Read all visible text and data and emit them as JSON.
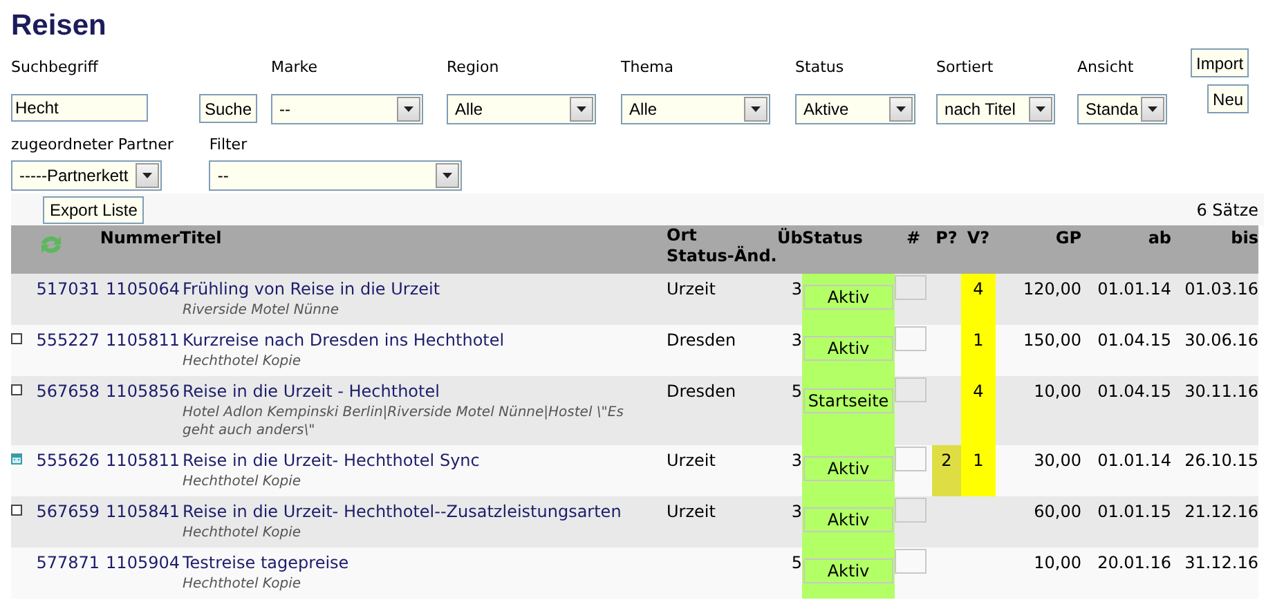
{
  "title": "Reisen",
  "search": {
    "label": "Suchbegriff",
    "value": "Hecht",
    "button": "Suche"
  },
  "selects": [
    {
      "label": "Marke",
      "value": "--"
    },
    {
      "label": "Region",
      "value": "Alle"
    },
    {
      "label": "Thema",
      "value": "Alle"
    },
    {
      "label": "Status",
      "value": "Aktive"
    },
    {
      "label": "Sortiert",
      "value": "nach Titel"
    },
    {
      "label": "Ansicht",
      "value": "Standa"
    }
  ],
  "import_button": "Import",
  "new_button": "Neu",
  "selects2": [
    {
      "label": "zugeordneter Partner",
      "value": "-----Partnerkett"
    },
    {
      "label": "Filter",
      "value": "--"
    }
  ],
  "export_button": "Export Liste",
  "record_count": "6 Sätze",
  "table": {
    "columns": {
      "nummer": "Nummer",
      "titel": "Titel",
      "ort": "Ort",
      "status_change": "Status-Änd.",
      "ub": "Üb",
      "status": "Status",
      "count": "#",
      "p": "P?",
      "v": "V?",
      "gp": "GP",
      "ab": "ab",
      "bis": "bis"
    },
    "rows": [
      {
        "kind": "none",
        "id": "517031",
        "nummer": "1105064",
        "title": "Frühling von Reise in die Urzeit",
        "subtitle": "Riverside Motel Nünne",
        "ort": "Urzeit",
        "ub": "3",
        "status": "Aktiv",
        "v": "4",
        "gp": "120,00",
        "ab": "01.01.14",
        "bis": "01.03.16"
      },
      {
        "kind": "box",
        "id": "555227",
        "nummer": "1105811",
        "title": "Kurzreise nach Dresden ins Hechthotel",
        "subtitle": "Hechthotel Kopie",
        "ort": "Dresden",
        "ub": "3",
        "status": "Aktiv",
        "v": "1",
        "gp": "150,00",
        "ab": "01.04.15",
        "bis": "30.06.16"
      },
      {
        "kind": "box",
        "id": "567658",
        "nummer": "1105856",
        "title": "Reise in die Urzeit - Hechthotel",
        "subtitle": "Hotel Adlon Kempinski Berlin|Riverside Motel Nünne|Hostel \\\"Es geht auch anders\\\"",
        "ort": "Dresden",
        "ub": "5",
        "status": "Startseite",
        "v": "4",
        "gp": "10,00",
        "ab": "01.04.15",
        "bis": "30.11.16"
      },
      {
        "kind": "calendar",
        "id": "555626",
        "nummer": "1105811",
        "title": "Reise in die Urzeit- Hechthotel Sync",
        "subtitle": "Hechthotel Kopie",
        "ort": "Urzeit",
        "ub": "3",
        "status": "Aktiv",
        "p": "2",
        "v": "1",
        "gp": "30,00",
        "ab": "01.01.14",
        "bis": "26.10.15"
      },
      {
        "kind": "box",
        "id": "567659",
        "nummer": "1105841",
        "title": "Reise in die Urzeit- Hechthotel--Zusatzleistungsarten",
        "subtitle": "Hechthotel Kopie",
        "ort": "Urzeit",
        "ub": "3",
        "status": "Aktiv",
        "gp": "60,00",
        "ab": "01.01.15",
        "bis": "21.12.16"
      },
      {
        "kind": "none",
        "id": "577871",
        "nummer": "1105904",
        "title": "Testreise tagepreise",
        "subtitle": "Hechthotel Kopie",
        "ub": "5",
        "status": "Aktiv",
        "gp": "10,00",
        "ab": "20.01.16",
        "bis": "31.12.16"
      }
    ]
  }
}
